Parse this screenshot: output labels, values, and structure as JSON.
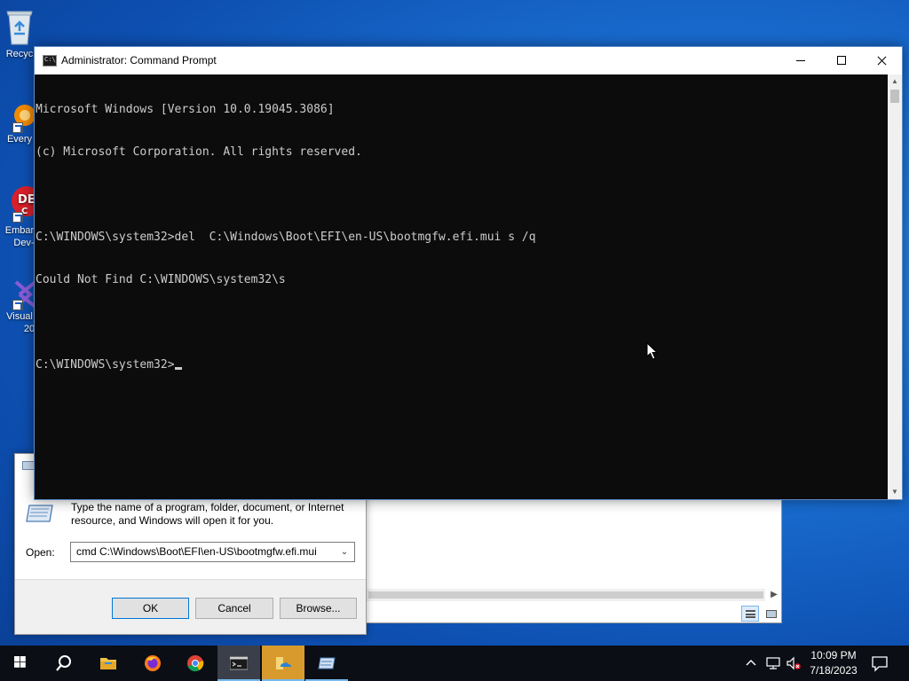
{
  "desktop": {
    "icons": [
      {
        "name": "recycle-bin",
        "label": "Recyc"
      },
      {
        "name": "everything",
        "label": "Every"
      },
      {
        "name": "embarcadero-dev",
        "label": "Embar",
        "label2": "Dev-"
      },
      {
        "name": "visual-studio",
        "label": "Visual",
        "label2": "20"
      }
    ]
  },
  "cmd": {
    "title": "Administrator: Command Prompt",
    "icon_text": "C:\\_",
    "lines": [
      "Microsoft Windows [Version 10.0.19045.3086]",
      "(c) Microsoft Corporation. All rights reserved.",
      "",
      "C:\\WINDOWS\\system32>del  C:\\Windows\\Boot\\EFI\\en-US\\bootmgfw.efi.mui s /q",
      "Could Not Find C:\\WINDOWS\\system32\\s",
      "",
      "C:\\WINDOWS\\system32>"
    ]
  },
  "run_dialog": {
    "description": "Type the name of a program, folder, document, or Internet resource, and Windows will open it for you.",
    "open_label": "Open:",
    "open_value": "cmd C:\\Windows\\Boot\\EFI\\en-US\\bootmgfw.efi.mui",
    "ok_label": "OK",
    "cancel_label": "Cancel",
    "browse_label": "Browse..."
  },
  "taskbar": {
    "time": "10:09 PM",
    "date": "7/18/2023"
  },
  "colors": {
    "console_bg": "#0c0c0c",
    "console_text": "#cccccc",
    "taskbar": "#0b0e14",
    "accent": "#76b9ed"
  }
}
